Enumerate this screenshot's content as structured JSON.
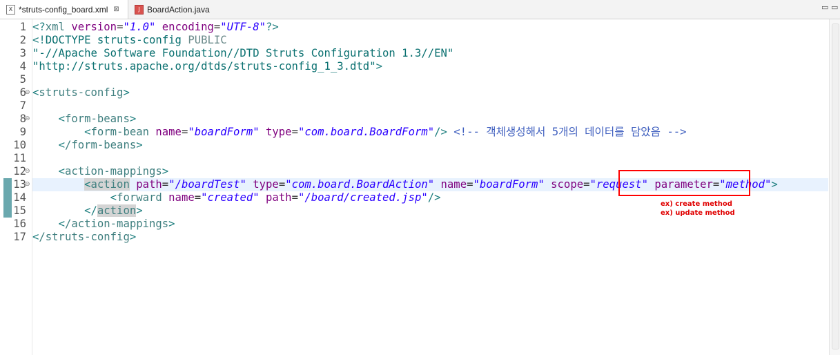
{
  "tabs": [
    {
      "label": "*struts-config_board.xml",
      "icon": "xml-file-icon",
      "active": true,
      "close": "⊠"
    },
    {
      "label": "BoardAction.java",
      "icon": "java-file-icon",
      "active": false
    }
  ],
  "window_controls": {
    "minimize": "▭",
    "maximize": "▭"
  },
  "line_numbers": [
    "1",
    "2",
    "3",
    "4",
    "5",
    "6",
    "7",
    "8",
    "9",
    "10",
    "11",
    "12",
    "13",
    "14",
    "15",
    "16",
    "17"
  ],
  "fold_markers": {
    "6": "⊖",
    "8": "⊖",
    "12": "⊖",
    "13": "⊖"
  },
  "code": {
    "l1": {
      "lt": "<?",
      "tag": "xml",
      "a1": "version",
      "v1": "\"1.0\"",
      "a2": "encoding",
      "v2": "\"UTF-8\"",
      "gt": "?>"
    },
    "l2": {
      "lt": "<!",
      "kw": "DOCTYPE struts-config",
      "pub": "PUBLIC"
    },
    "l3": {
      "text": "\"-//Apache Software Foundation//DTD Struts Configuration 1.3//EN\""
    },
    "l4": {
      "text": "\"http://struts.apache.org/dtds/struts-config_1_3.dtd\"",
      "gt": ">"
    },
    "l6": {
      "text": "struts-config"
    },
    "l8": {
      "text": "form-beans"
    },
    "l9": {
      "tag": "form-bean",
      "a1": "name",
      "v1": "\"boardForm\"",
      "a2": "type",
      "v2": "\"com.board.BoardForm\"",
      "comment": "<!-- 객체생성해서 5개의 데이터를 담았음 -->"
    },
    "l10": {
      "text": "/form-beans"
    },
    "l12": {
      "text": "action-mappings"
    },
    "l13": {
      "tag": "action",
      "a1": "path",
      "v1": "\"/boardTest\"",
      "a2": "type",
      "v2": "\"com.board.BoardAction\"",
      "a3": "name",
      "v3": "\"boardForm\"",
      "a4": "scope",
      "v4": "\"request\"",
      "a5": "parameter",
      "v5": "\"method\""
    },
    "l14": {
      "tag": "forward",
      "a1": "name",
      "v1": "\"created\"",
      "a2": "path",
      "v2": "\"/board/created.jsp\""
    },
    "l15": {
      "tag": "action"
    },
    "l16": {
      "text": "/action-mappings"
    },
    "l17": {
      "text": "/struts-config"
    }
  },
  "annotations": {
    "note1": "ex) create method",
    "note2": "ex) update method",
    "highlight_color": "#ff0000"
  },
  "colors": {
    "tag": "#3f7f7f",
    "attribute": "#7f007f",
    "value": "#2a00ff",
    "comment": "#3f5fbf",
    "current_line": "#e8f2fe"
  }
}
